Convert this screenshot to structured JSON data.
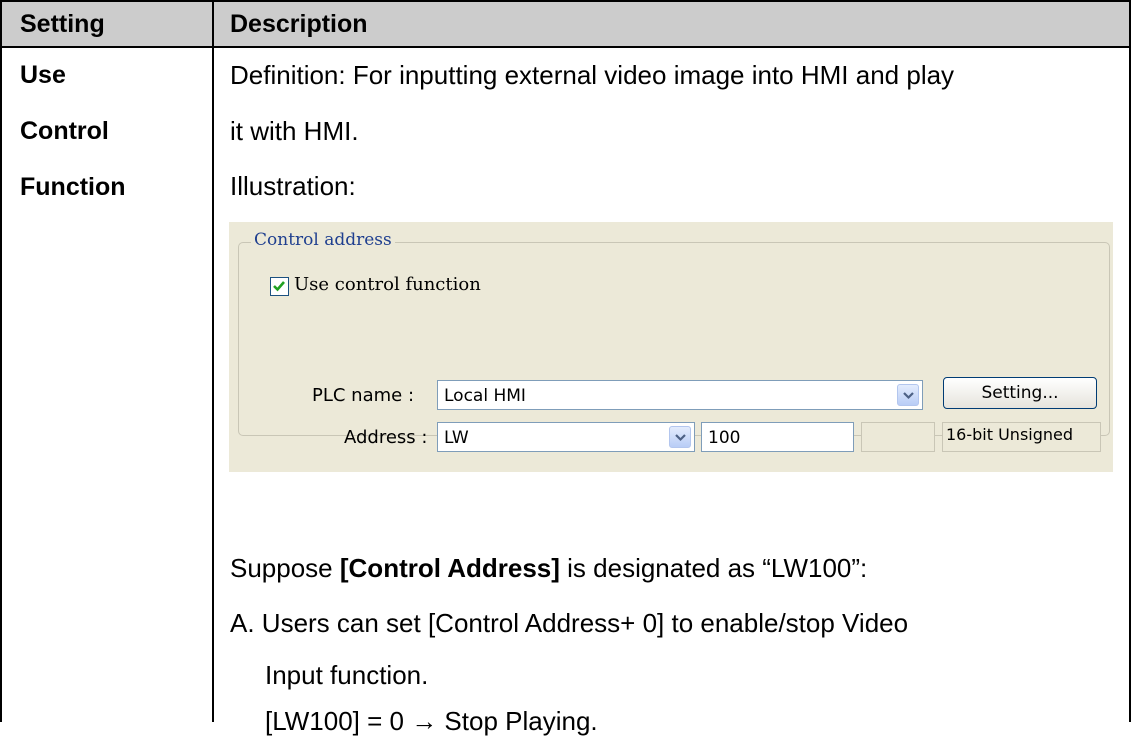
{
  "table": {
    "headers": {
      "setting": "Setting",
      "description": "Description"
    },
    "setting_lines": [
      "Use",
      "Control",
      "Function"
    ],
    "description": {
      "definition_line1": "Definition: For inputting external video image into HMI and play",
      "definition_line2": "it with HMI.",
      "illustration_label": "Illustration:",
      "suppose_prefix": "Suppose ",
      "suppose_bold": "[Control Address]",
      "suppose_suffix": " is designated as “LW100”:",
      "item_a_line1": "A.  Users can set [Control Address+ 0] to enable/stop Video",
      "item_a_line2": "Input function.",
      "item_a_line3": "[LW100] = 0 → Stop Playing."
    }
  },
  "illustration": {
    "group_title": "Control address",
    "checkbox_label": "Use control function",
    "checkbox_checked": true,
    "plc_label": "PLC name :",
    "plc_value": "Local HMI",
    "setting_button": "Setting...",
    "address_label": "Address :",
    "address_device": "LW",
    "address_value": "100",
    "address_type": "16-bit Unsigned"
  },
  "colors": {
    "header_bg": "#cccccc",
    "dialog_bg": "#ece9d8",
    "group_title": "#1f3f8f",
    "check": "#21a121"
  }
}
